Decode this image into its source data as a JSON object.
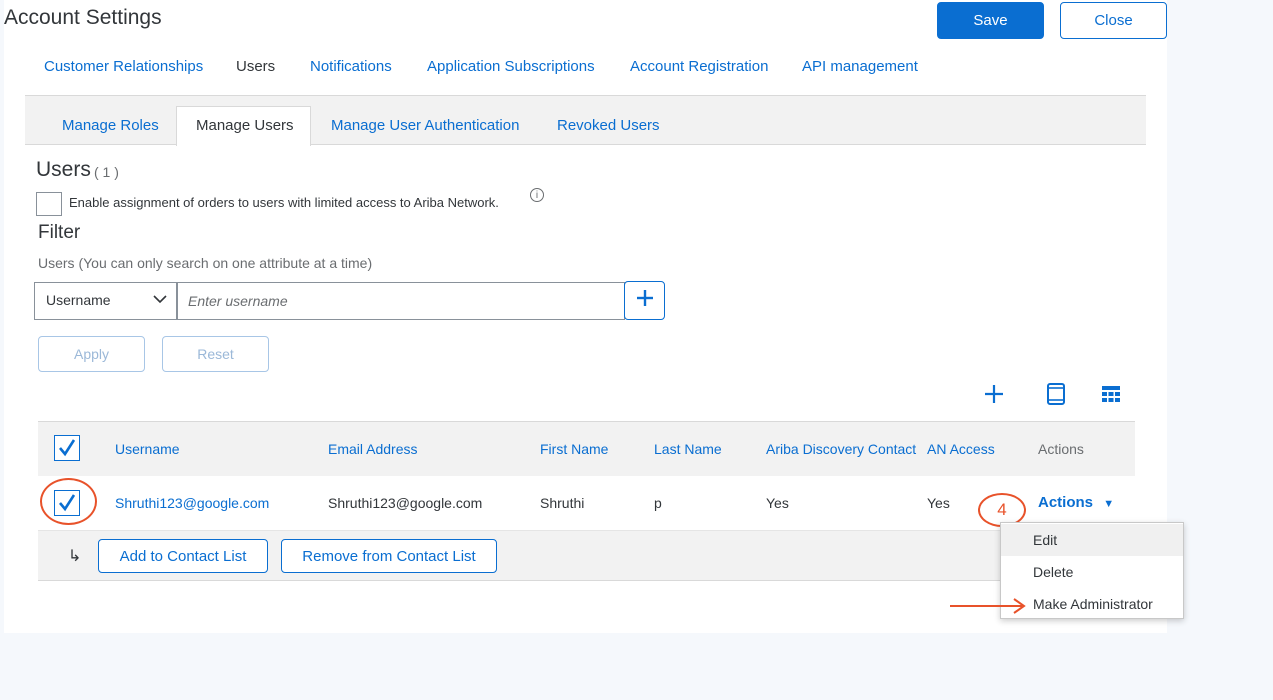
{
  "header": {
    "title": "Account Settings",
    "save_label": "Save",
    "close_label": "Close"
  },
  "top_tabs": [
    {
      "label": "Customer Relationships",
      "active": false
    },
    {
      "label": "Users",
      "active": true
    },
    {
      "label": "Notifications",
      "active": false
    },
    {
      "label": "Application Subscriptions",
      "active": false
    },
    {
      "label": "Account Registration",
      "active": false
    },
    {
      "label": "API management",
      "active": false
    }
  ],
  "sub_tabs": [
    {
      "label": "Manage Roles",
      "active": false
    },
    {
      "label": "Manage Users",
      "active": true
    },
    {
      "label": "Manage User Authentication",
      "active": false
    },
    {
      "label": "Revoked Users",
      "active": false
    }
  ],
  "users": {
    "title": "Users",
    "count": "( 1 )",
    "limited_access_label": "Enable assignment of orders to users with limited access to Ariba Network.",
    "limited_access_checked": false
  },
  "filter": {
    "title": "Filter",
    "hint": "Users (You can only search on one attribute at a time)",
    "attribute": "Username",
    "placeholder": "Enter username",
    "apply_label": "Apply",
    "reset_label": "Reset"
  },
  "table": {
    "columns": [
      "Username",
      "Email Address",
      "First Name",
      "Last Name",
      "Ariba Discovery Contact",
      "AN Access",
      "Actions"
    ],
    "rows": [
      {
        "username": "Shruthi123@google.com",
        "email": "Shruthi123@google.com",
        "first_name": "Shruthi",
        "last_name": "p",
        "discovery_contact": "Yes",
        "an_access": "Yes",
        "actions_label": "Actions",
        "selected": true
      }
    ],
    "add_contact_label": "Add to Contact List",
    "remove_contact_label": "Remove from Contact List"
  },
  "actions_menu": {
    "items": [
      "Edit",
      "Delete",
      "Make Administrator"
    ]
  },
  "annotation": {
    "step": "4",
    "color": "#e8522a"
  },
  "colors": {
    "accent": "#0a6ed1",
    "annotation": "#e8522a"
  }
}
